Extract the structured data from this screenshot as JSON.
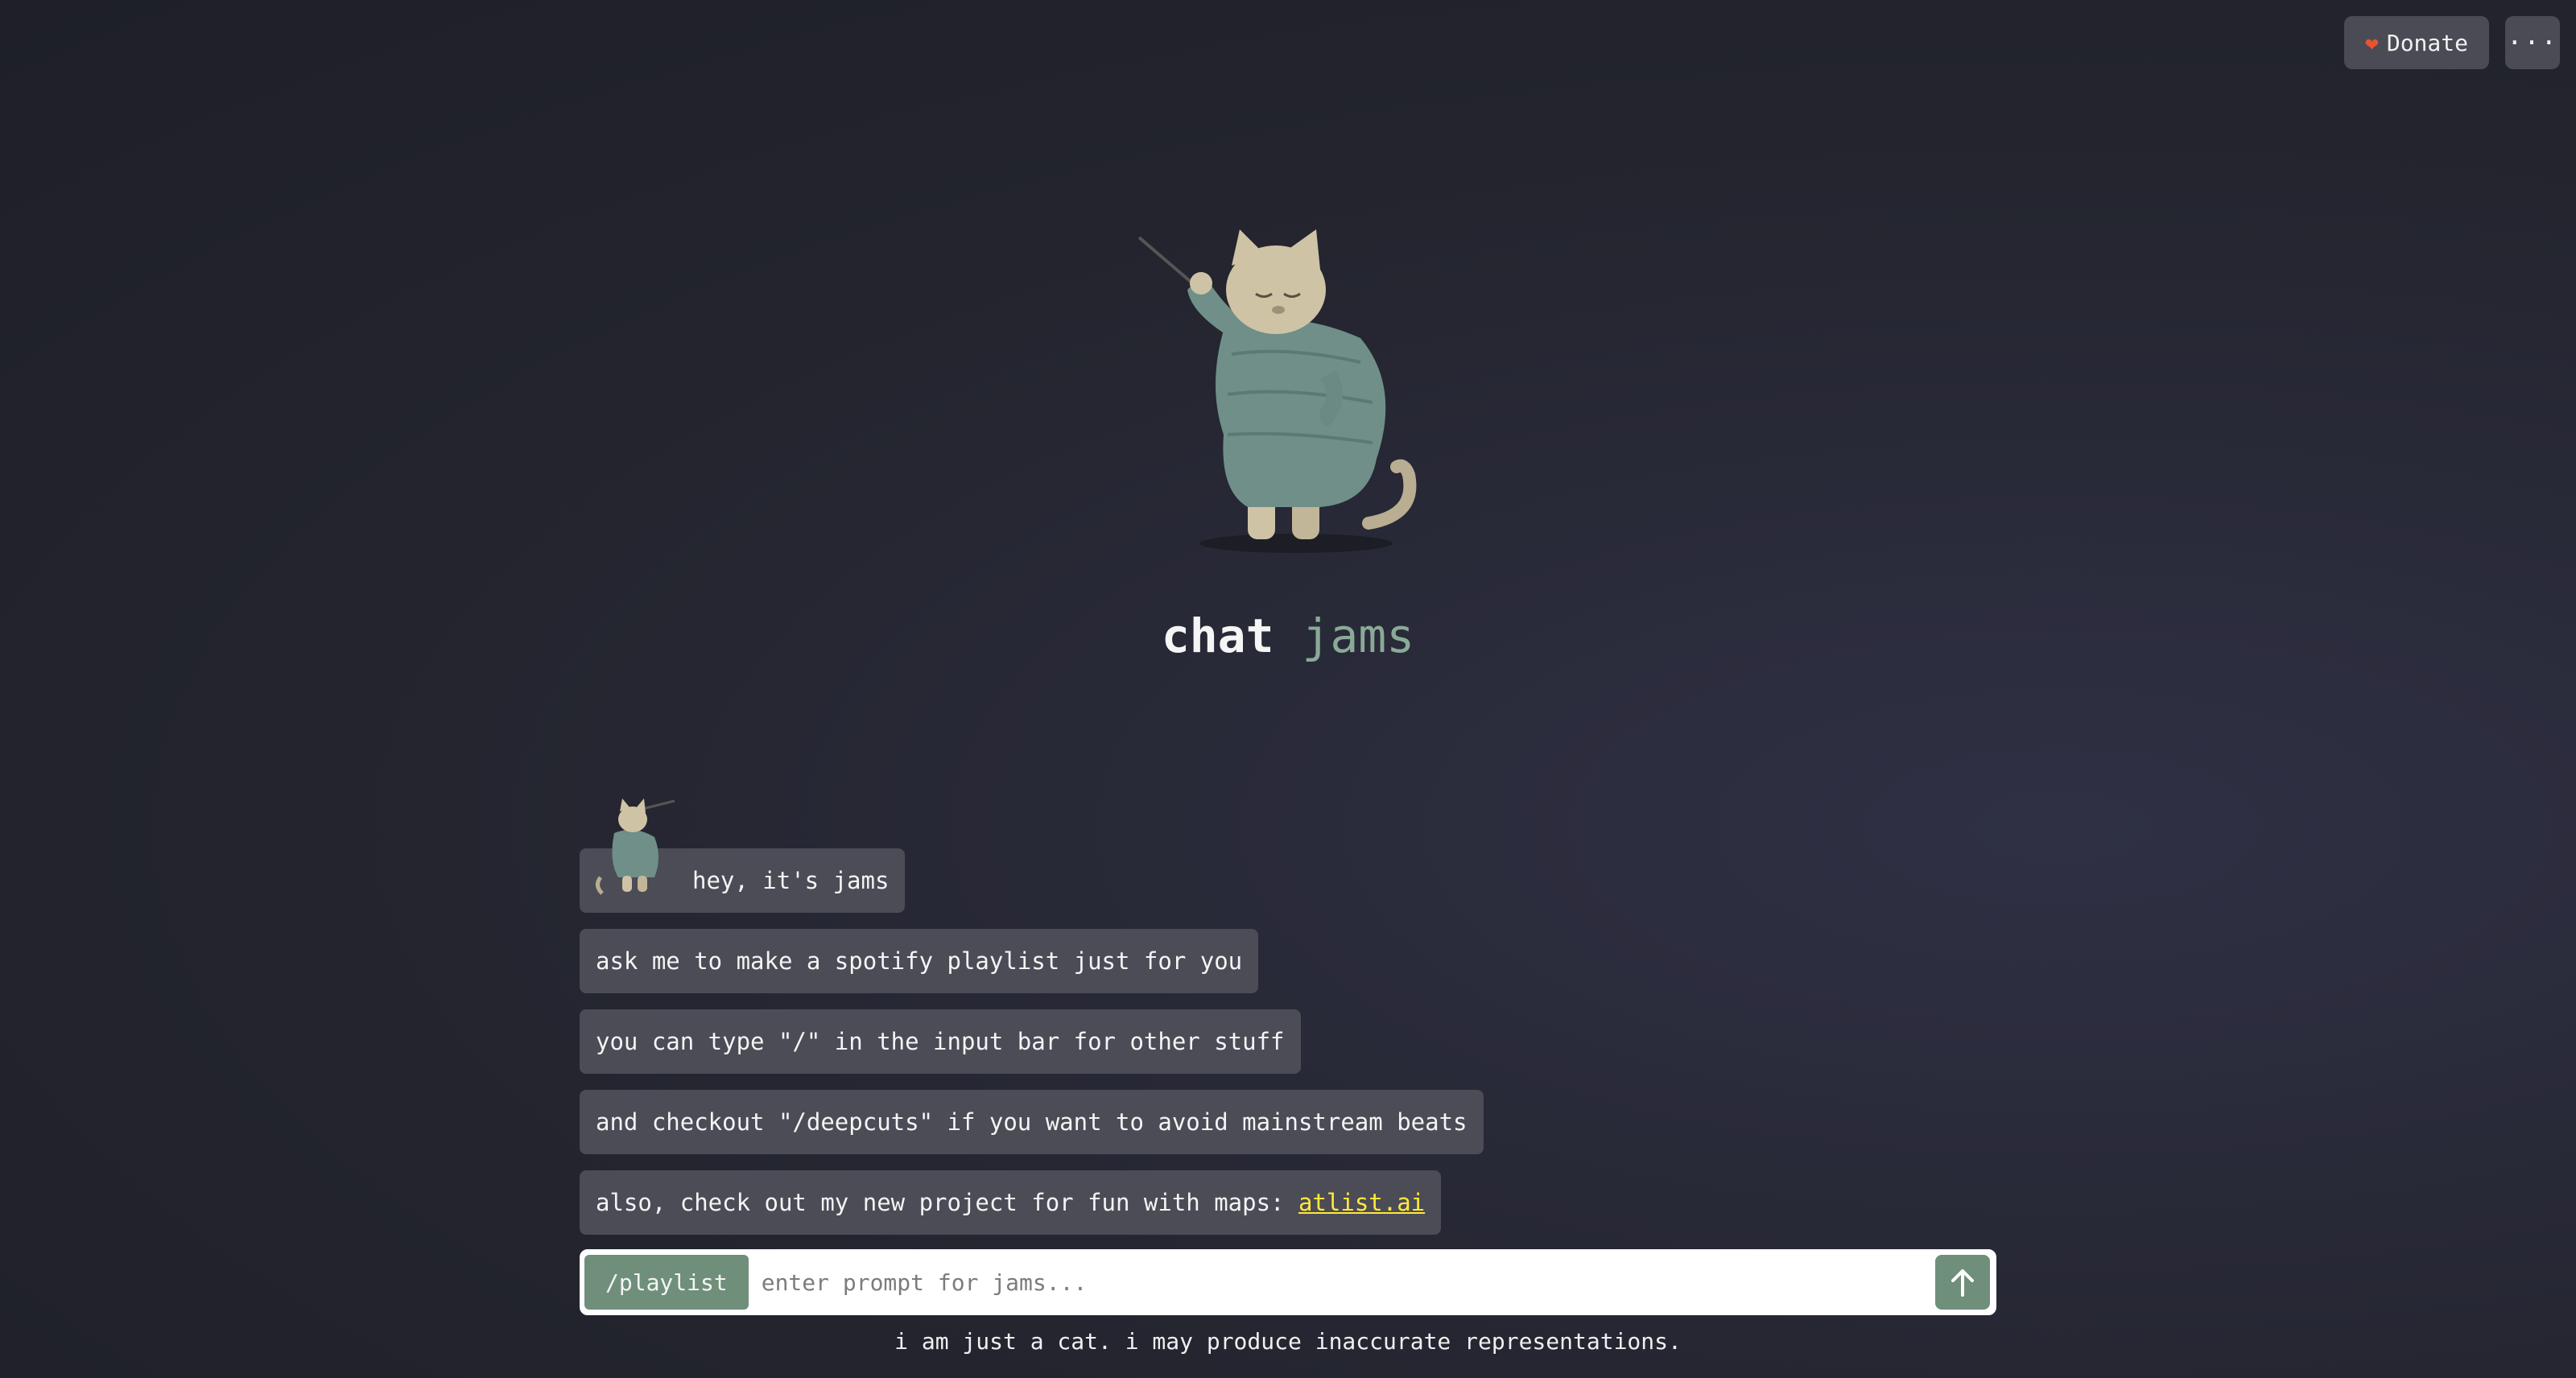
{
  "header": {
    "donate_label": "Donate",
    "donate_icon": "heart-icon",
    "more_label": "···"
  },
  "brand": {
    "title_word1": "chat",
    "title_word2": "jams",
    "accent_color": "#8aaa98"
  },
  "messages": [
    {
      "text": "hey, it's jams"
    },
    {
      "text": "ask me to make a spotify playlist just for you"
    },
    {
      "text": "you can type \"/\" in the input bar for other stuff"
    },
    {
      "text": "and checkout \"/deepcuts\" if you want to avoid mainstream beats"
    },
    {
      "text_prefix": "also, check out my new project for fun with maps: ",
      "link_text": "atlist.ai"
    }
  ],
  "input": {
    "command_chip": "/playlist",
    "placeholder": "enter prompt for jams...",
    "value": "",
    "send_icon": "arrow-up-icon"
  },
  "footer": {
    "disclaimer": "i am just a cat. i may produce inaccurate representations."
  }
}
